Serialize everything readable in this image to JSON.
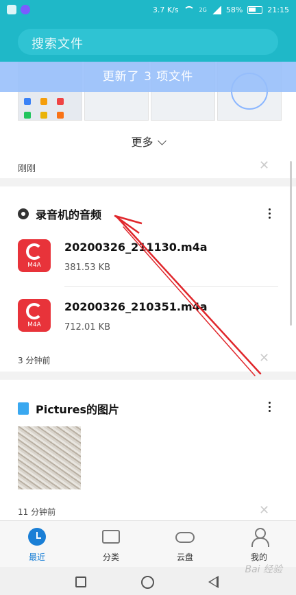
{
  "status_bar": {
    "network_speed": "3.7 K/s",
    "signal_label": "2G",
    "battery": "58%",
    "time": "21:15"
  },
  "search": {
    "placeholder": "搜索文件"
  },
  "toast": {
    "text": "更新了 3 项文件"
  },
  "more_label": "更多",
  "recent_group": {
    "time_label": "刚刚",
    "close_icon": "close-icon"
  },
  "recorder_card": {
    "title": "录音机的音频",
    "icon": "recorder-icon",
    "files": [
      {
        "name": "20200326_211130.m4a",
        "size": "381.53 KB",
        "type": "M4A"
      },
      {
        "name": "20200326_210351.m4a",
        "size": "712.01 KB",
        "type": "M4A"
      }
    ],
    "time_label": "3 分钟前"
  },
  "pictures_card": {
    "title": "Pictures的图片",
    "icon": "picture-folder-icon",
    "time_label": "11 分钟前"
  },
  "tabs": [
    {
      "label": "最近",
      "icon": "clock-icon",
      "active": true
    },
    {
      "label": "分类",
      "icon": "folder-icon",
      "active": false
    },
    {
      "label": "云盘",
      "icon": "cloud-icon",
      "active": false
    },
    {
      "label": "我的",
      "icon": "person-icon",
      "active": false
    }
  ],
  "watermark": "Bai 经验",
  "colors": {
    "header": "#1fb8c8",
    "accent": "#1a7fd6",
    "annotation_arrow": "#e0262b",
    "m4a_icon": "#e8333a"
  }
}
